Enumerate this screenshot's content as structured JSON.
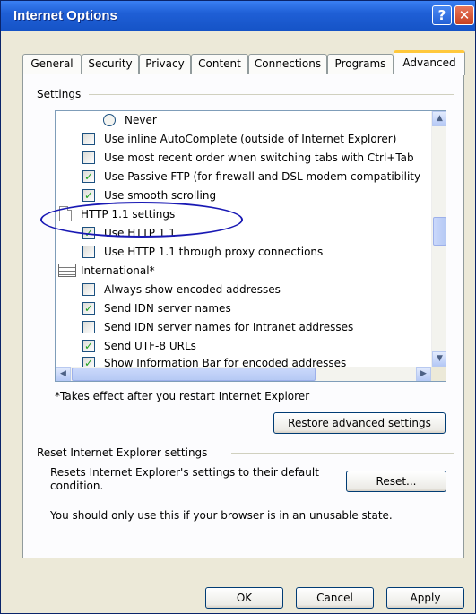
{
  "window": {
    "title": "Internet Options"
  },
  "titlebar": {
    "help_glyph": "?",
    "close_glyph": "✕"
  },
  "tabs": [
    {
      "label": "General"
    },
    {
      "label": "Security"
    },
    {
      "label": "Privacy"
    },
    {
      "label": "Content"
    },
    {
      "label": "Connections"
    },
    {
      "label": "Programs"
    },
    {
      "label": "Advanced",
      "active": true
    }
  ],
  "settings": {
    "group_label": "Settings",
    "items": [
      {
        "type": "radio",
        "label": "Never",
        "checked": false
      },
      {
        "type": "checkbox",
        "label": "Use inline AutoComplete (outside of Internet Explorer)",
        "checked": false
      },
      {
        "type": "checkbox",
        "label": "Use most recent order when switching tabs with Ctrl+Tab",
        "checked": false
      },
      {
        "type": "checkbox",
        "label": "Use Passive FTP (for firewall and DSL modem compatibility",
        "checked": true
      },
      {
        "type": "checkbox",
        "label": "Use smooth scrolling",
        "checked": true
      },
      {
        "type": "category",
        "label": "HTTP 1.1 settings",
        "icon": "document-icon"
      },
      {
        "type": "checkbox",
        "label": "Use HTTP 1.1",
        "checked": true
      },
      {
        "type": "checkbox",
        "label": "Use HTTP 1.1 through proxy connections",
        "checked": false
      },
      {
        "type": "category",
        "label": "International*",
        "icon": "list-grid-icon"
      },
      {
        "type": "checkbox",
        "label": "Always show encoded addresses",
        "checked": false
      },
      {
        "type": "checkbox",
        "label": "Send IDN server names",
        "checked": true
      },
      {
        "type": "checkbox",
        "label": "Send IDN server names for Intranet addresses",
        "checked": false
      },
      {
        "type": "checkbox",
        "label": "Send UTF-8 URLs",
        "checked": true
      },
      {
        "type": "checkbox",
        "label": "Show Information Bar for encoded addresses",
        "checked": true
      }
    ],
    "note": "*Takes effect after you restart Internet Explorer",
    "restore_button": "Restore advanced settings"
  },
  "reset": {
    "group_label": "Reset Internet Explorer settings",
    "description": "Resets Internet Explorer's settings to their default condition.",
    "button": "Reset...",
    "warning": "You should only use this if your browser is in an unusable state."
  },
  "footer": {
    "ok": "OK",
    "cancel": "Cancel",
    "apply": "Apply"
  },
  "colors": {
    "title_bar": "#1f5fd6",
    "annotation_ellipse": "#1919b4",
    "check_mark": "#21a121"
  }
}
